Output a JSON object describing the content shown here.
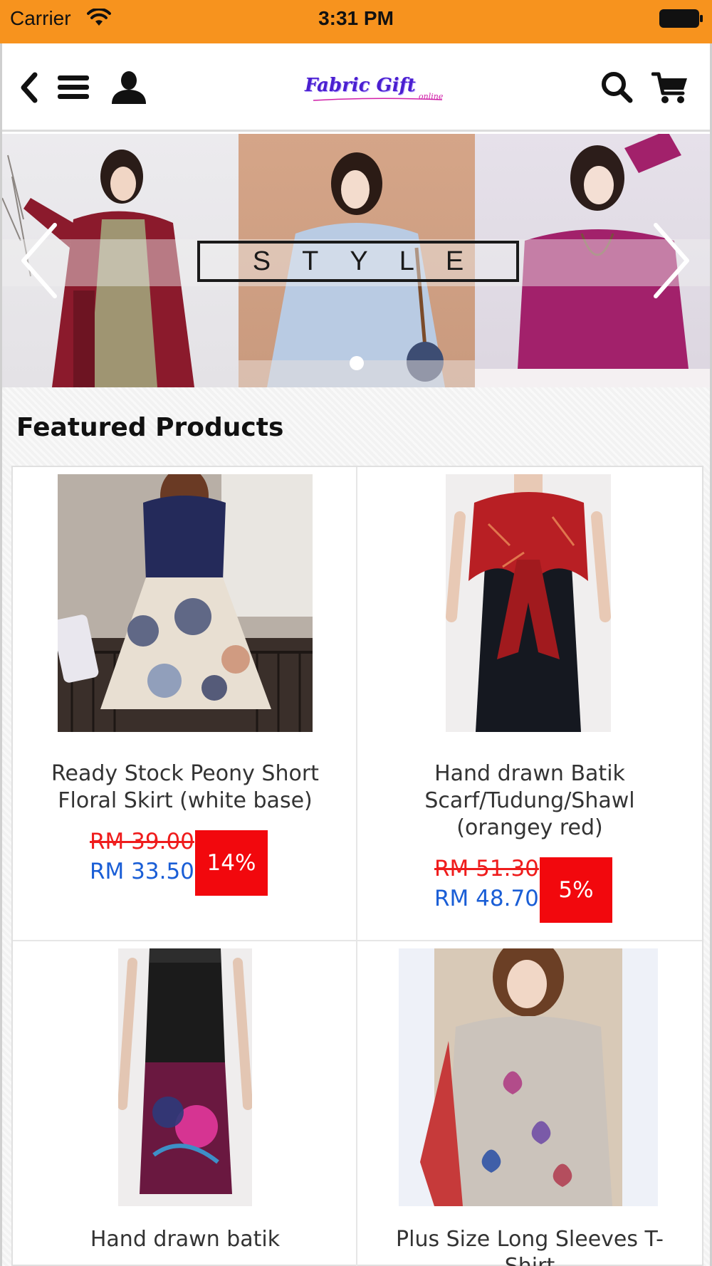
{
  "status_bar": {
    "carrier": "Carrier",
    "time": "3:31 PM"
  },
  "header": {
    "logo_text": "Fabric Gift",
    "logo_sub": "online",
    "icons": [
      "back-icon",
      "menu-icon",
      "user-icon",
      "search-icon",
      "cart-icon"
    ]
  },
  "banner": {
    "text": "STYLE",
    "active_slide": 1,
    "slide_count": 1
  },
  "featured": {
    "title": "Featured Products",
    "products": [
      {
        "name": "Ready Stock Peony Short Floral Skirt (white base)",
        "old_price": "RM 39.00",
        "new_price": "RM 33.50",
        "discount": "14%"
      },
      {
        "name": "Hand drawn Batik Scarf/Tudung/Shawl (orangey red)",
        "old_price": "RM 51.30",
        "new_price": "RM 48.70",
        "discount": "5%"
      },
      {
        "name": "Hand drawn batik"
      },
      {
        "name": "Plus Size Long Sleeves T-Shirt"
      }
    ]
  },
  "colors": {
    "status_bar": "#f7931e",
    "old_price": "#ef1c1c",
    "new_price": "#1a5ed6",
    "discount_badge": "#f2080d",
    "logo": "#4b1fd0"
  }
}
